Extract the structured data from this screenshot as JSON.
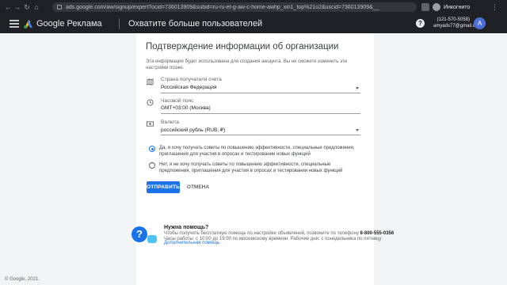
{
  "browser": {
    "url": "ads.google.com/aw/signup/expert?ocid=736013909&subid=ru-ru-et-g-aw-c-home-awhp_xin1_top%21o2&uscid=736013909&__",
    "incognito_label": "Инкогнито"
  },
  "header": {
    "brand": "Google Реклама",
    "page_title": "Охватите больше пользователей",
    "account_phone": "(121-570-5058)",
    "account_email": "amyads77@gmail.com",
    "avatar_letter": "A"
  },
  "form": {
    "title": "Подтверждение информации об организации",
    "subtitle": "Эта информация будет использована для создания аккаунта. Вы не сможете изменить эти настройки позже.",
    "fields": [
      {
        "label": "Страна получателя счета",
        "value": "Российская Федерация",
        "icon": "map-icon"
      },
      {
        "label": "Часовой пояс",
        "value": "GMT+03:00 (Москва)",
        "icon": "clock-icon"
      },
      {
        "label": "Валюта",
        "value": "российский рубль (RUB, ₽)",
        "icon": "currency-icon"
      }
    ],
    "options": [
      {
        "text": "Да, я хочу получать советы по повышению эффективности, специальные предложения, приглашения для участия в опросах и тестировании новых функций",
        "selected": true
      },
      {
        "text": "Нет, я не хочу получать советы по повышению эффективности, специальные предложения, приглашения для участия в опросах и тестировании новых функций",
        "selected": false
      }
    ],
    "submit_label": "ОТПРАВИТЬ",
    "cancel_label": "ОТМЕНА"
  },
  "help": {
    "title": "Нужна помощь?",
    "line1": "Чтобы получить бесплатную помощь по настройке объявлений, позвоните по телефону",
    "phone": "8-800-555-0356",
    "line2": "Часы работы: с 10:00 до 19:00 по московскому времени. Рабочие дни: с понедельника по пятницу",
    "link": "Дополнительная помощь"
  },
  "footer": "© Google, 2021.",
  "colors": {
    "accent": "#1a73e8",
    "header_bg": "#202124",
    "page_bg": "#f1f3f4"
  }
}
